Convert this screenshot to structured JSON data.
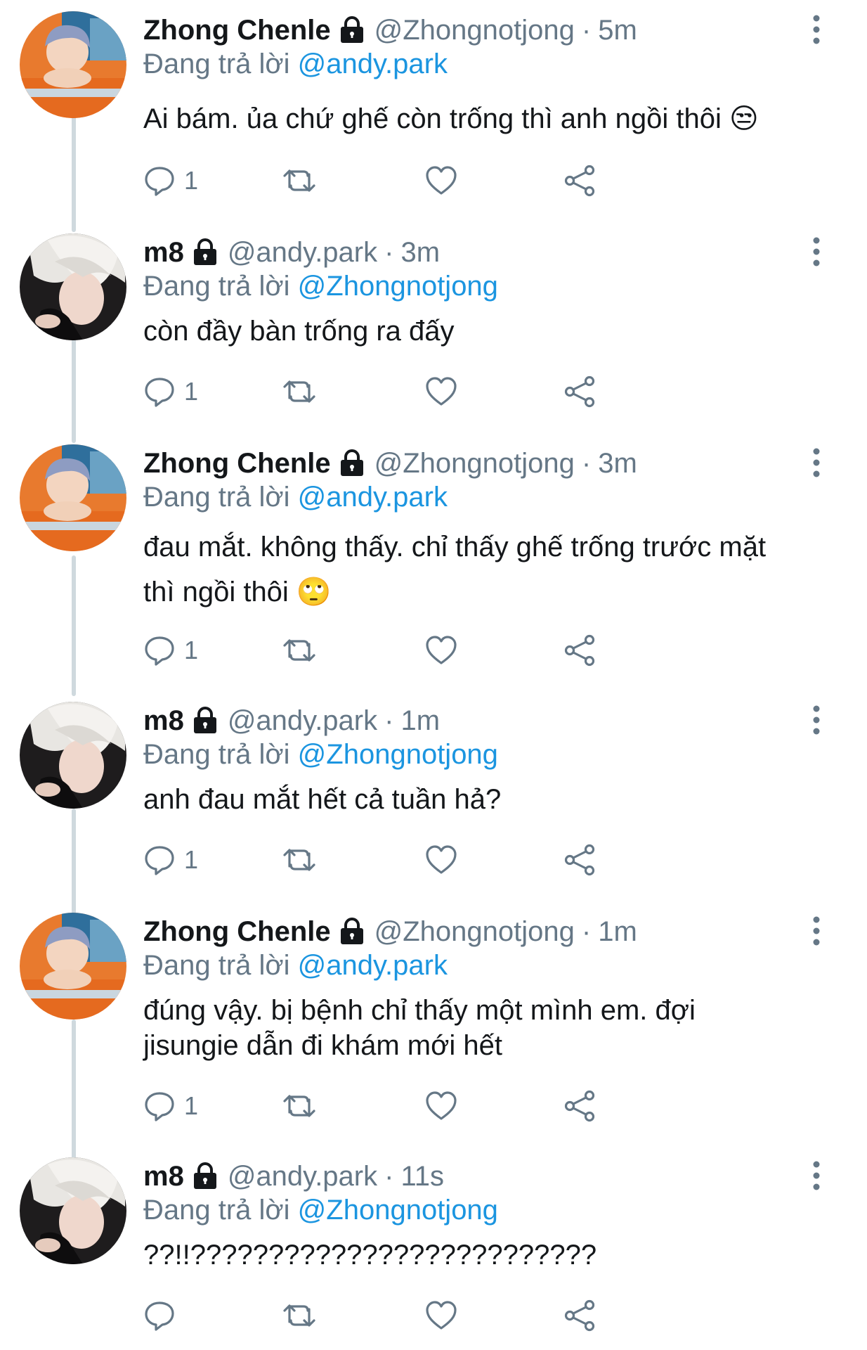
{
  "users": {
    "chenle": {
      "display_name": "Zhong Chenle",
      "handle": "@Zhongnotjong"
    },
    "andy": {
      "display_name": "m8",
      "handle": "@andy.park"
    }
  },
  "replying_prefix": "Đang trả lời",
  "separator": "·",
  "tweets": [
    {
      "author_name": "Zhong Chenle",
      "author_handle": "@Zhongnotjong",
      "time": "5m",
      "replying_to": "@andy.park",
      "text_lines": [
        "Ai bám. ủa chứ ghế còn trống thì anh ngồi thôi 😒"
      ],
      "reply_count": "1"
    },
    {
      "author_name": "m8",
      "author_handle": "@andy.park",
      "time": "3m",
      "replying_to": "@Zhongnotjong",
      "text_lines": [
        "còn đầy bàn trống ra đấy"
      ],
      "reply_count": "1"
    },
    {
      "author_name": "Zhong Chenle",
      "author_handle": "@Zhongnotjong",
      "time": "3m",
      "replying_to": "@andy.park",
      "text_lines": [
        "đau mắt. không thấy. chỉ thấy ghế trống trước mặt",
        "thì ngồi thôi 🙄"
      ],
      "reply_count": "1"
    },
    {
      "author_name": "m8",
      "author_handle": "@andy.park",
      "time": "1m",
      "replying_to": "@Zhongnotjong",
      "text_lines": [
        "anh đau mắt hết cả tuần hả?"
      ],
      "reply_count": "1"
    },
    {
      "author_name": "Zhong Chenle",
      "author_handle": "@Zhongnotjong",
      "time": "1m",
      "replying_to": "@andy.park",
      "text_lines": [
        "đúng vậy. bị bệnh chỉ thấy một mình em. đợi",
        "jisungie dẫn đi khám mới hết"
      ],
      "reply_count": "1"
    },
    {
      "author_name": "m8",
      "author_handle": "@andy.park",
      "time": "11s",
      "replying_to": "@Zhongnotjong",
      "text_lines": [
        "??!!??????????????????????????"
      ],
      "reply_count": ""
    }
  ],
  "colors": {
    "text": "#14171a",
    "muted": "#657786",
    "mention": "#1b95e0",
    "thread_line": "#cfd9de"
  },
  "icons": [
    "lock-icon",
    "more-icon",
    "reply-icon",
    "retweet-icon",
    "like-icon",
    "share-icon"
  ]
}
